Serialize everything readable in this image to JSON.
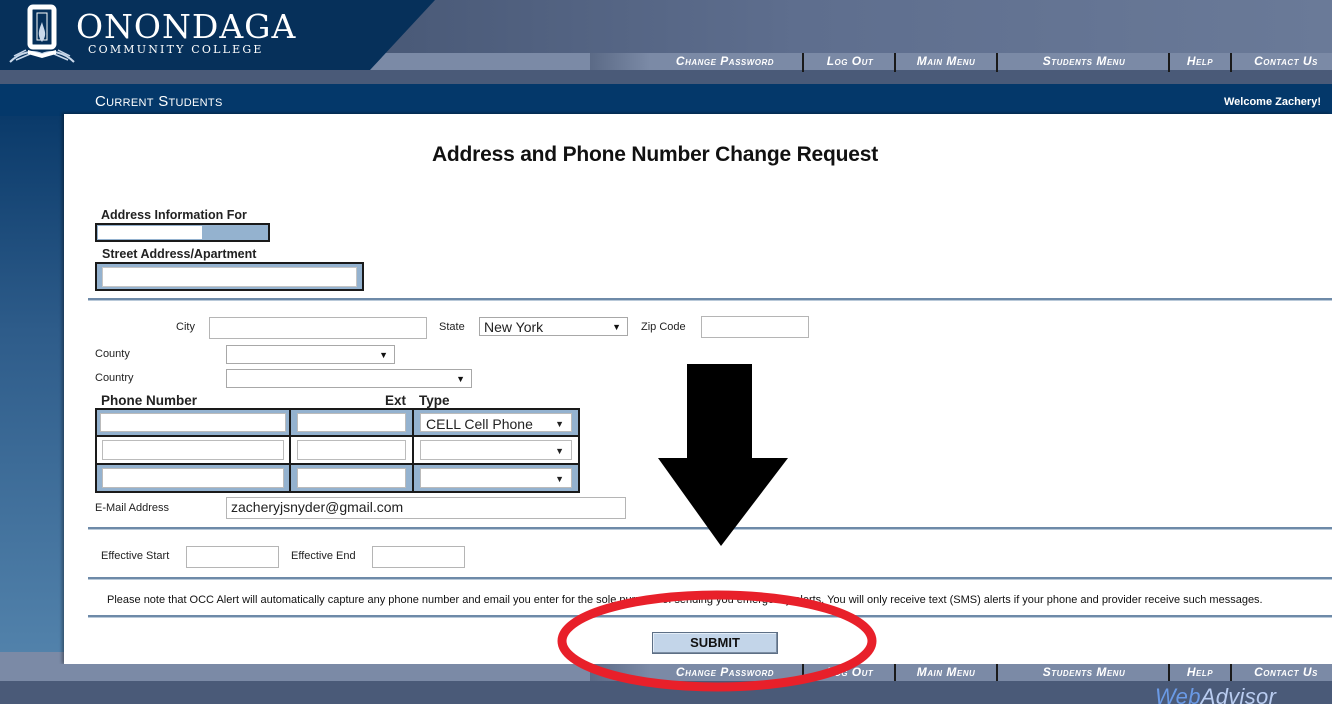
{
  "brand": {
    "name": "ONONDAGA",
    "subtitle": "COMMUNITY COLLEGE",
    "footer_logo_part1": "Web",
    "footer_logo_part2": "Advisor"
  },
  "nav": {
    "items": [
      {
        "label": "Change Password"
      },
      {
        "label": "Log Out"
      },
      {
        "label": "Main Menu"
      },
      {
        "label": "Students Menu"
      },
      {
        "label": "Help"
      },
      {
        "label": "Contact Us"
      }
    ]
  },
  "header": {
    "section_title": "Current Students",
    "welcome": "Welcome Zachery!"
  },
  "form": {
    "title": "Address and Phone Number Change Request",
    "address_info_label": "Address Information For",
    "address_info_value": "",
    "street_label": "Street Address/Apartment",
    "street_value": "",
    "city_label": "City",
    "city_value": "",
    "state_label": "State",
    "state_value": "New York",
    "zip_label": "Zip Code",
    "zip_value": "",
    "county_label": "County",
    "county_value": "",
    "country_label": "Country",
    "country_value": "",
    "phone_header": "Phone Number",
    "ext_header": "Ext",
    "type_header": "Type",
    "phones": [
      {
        "number": "",
        "ext": "",
        "type": "CELL Cell Phone"
      },
      {
        "number": "",
        "ext": "",
        "type": ""
      },
      {
        "number": "",
        "ext": "",
        "type": ""
      }
    ],
    "email_label": "E-Mail Address",
    "email_value": "zacheryjsnyder@gmail.com",
    "effective_start_label": "Effective Start",
    "effective_start_value": "",
    "effective_end_label": "Effective End",
    "effective_end_value": "",
    "note": "Please note that OCC Alert will automatically capture any phone number and email you enter for the sole purpose of sending you emergency alerts. You will only receive text (SMS) alerts if your phone and provider receive such messages.",
    "submit_label": "SUBMIT"
  },
  "icons": {
    "dropdown_arrow": "▼"
  },
  "annotations": {
    "arrow_color": "#000000",
    "circle_color": "#e8202a"
  }
}
